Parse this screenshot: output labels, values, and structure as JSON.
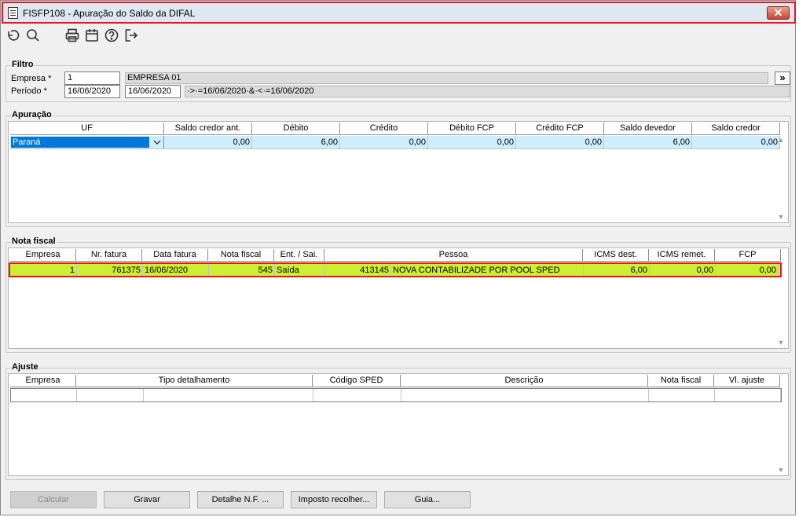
{
  "window": {
    "title": "FISFP108 - Apuração do Saldo da DIFAL",
    "close_label": "✕"
  },
  "toolbar": {
    "buttons": [
      {
        "icon": "undo-icon"
      },
      {
        "icon": "search-icon"
      },
      {
        "icon": "print-icon"
      },
      {
        "icon": "calendar-icon"
      },
      {
        "icon": "help-icon"
      },
      {
        "icon": "exit-icon"
      }
    ]
  },
  "filtro": {
    "label": "Filtro",
    "empresa_label": "Empresa *",
    "empresa_value": "1",
    "empresa_name": "EMPRESA 01",
    "periodo_label": "Período *",
    "periodo_start": "16/06/2020",
    "periodo_end": "16/06/2020",
    "periodo_expr": "·>·=16/06/2020·&·<·=16/06/2020",
    "more_label": "»"
  },
  "apuracao": {
    "label": "Apuração",
    "columns": [
      "UF",
      "Saldo credor ant.",
      "Débito",
      "Crédito",
      "Débito FCP",
      "Crédito FCP",
      "Saldo devedor",
      "Saldo credor"
    ],
    "rows": [
      [
        "Paraná",
        "0,00",
        "6,00",
        "0,00",
        "0,00",
        "0,00",
        "6,00",
        "0,00"
      ]
    ]
  },
  "nota_fiscal": {
    "label": "Nota fiscal",
    "columns": [
      "Empresa",
      "Nr. fatura",
      "Data fatura",
      "Nota fiscal",
      "Ent. / Sai.",
      "Pessoa",
      "ICMS dest.",
      "ICMS remet.",
      "FCP"
    ],
    "rows": [
      [
        "1",
        "761375",
        "16/06/2020",
        "545",
        "Saída",
        "413145",
        "NOVA CONTABILIZADE POR POOL SPED",
        "6,00",
        "0,00",
        "0,00"
      ]
    ]
  },
  "ajuste": {
    "label": "Ajuste",
    "columns": [
      "Empresa",
      "Tipo detalhamento",
      "Código SPED",
      "Descrição",
      "Nota fiscal",
      "Vl. ajuste"
    ]
  },
  "buttons": {
    "calcular": "Calcular",
    "gravar": "Gravar",
    "detalhe": "Detalhe N.F. ...",
    "imposto": "Imposto recolher...",
    "guia": "Guia..."
  },
  "colors": {
    "highlight_row": "#ccee33",
    "selected_row": "#cfeefc",
    "accent_border": "#e8151b"
  }
}
